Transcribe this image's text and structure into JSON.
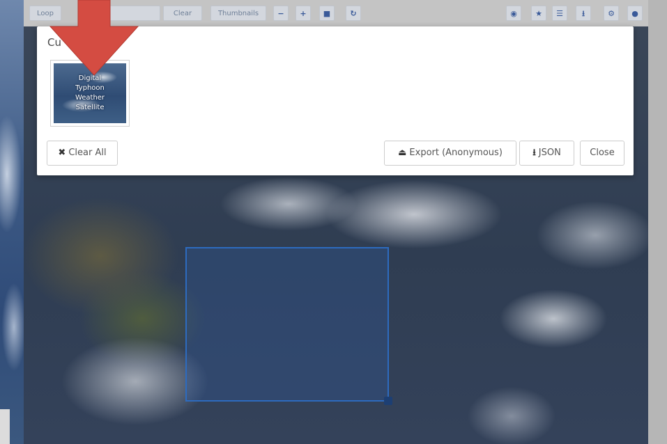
{
  "toolbar": {
    "left_buttons": [
      "Loop",
      "",
      "Clear",
      "Thumbnails"
    ],
    "center_icons": [
      "minus-icon",
      "plus-icon",
      "square-icon",
      "refresh-icon"
    ],
    "right_icons": [
      "globe-icon",
      "star-icon",
      "list-icon",
      "download-icon",
      "gear-icon",
      "info-icon"
    ]
  },
  "modal": {
    "title": "Cu",
    "thumbnail_lines": [
      "Digital",
      "Typhoon",
      "Weather",
      "Satellite"
    ],
    "buttons": {
      "clear_all": "Clear All",
      "export": "Export (Anonymous)",
      "json": "JSON",
      "close": "Close"
    }
  },
  "colors": {
    "arrow": "#d44c42",
    "selection": "#2d6bbf",
    "toolbar_icon": "#3a5a99"
  }
}
